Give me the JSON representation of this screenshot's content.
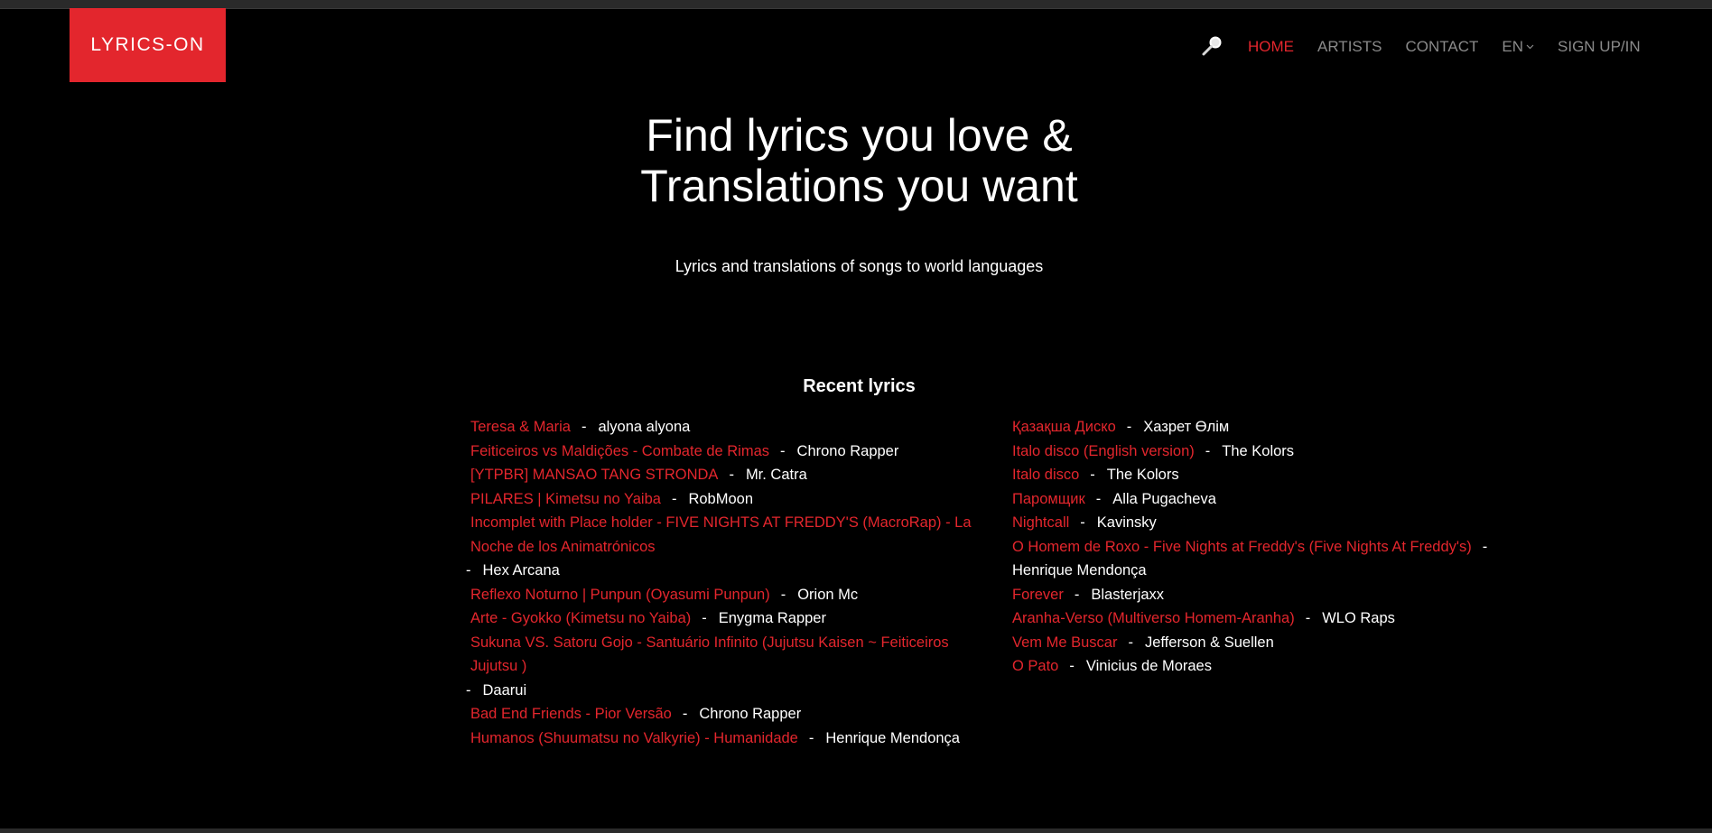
{
  "brand": {
    "logo_text": "LYRICS-ON"
  },
  "nav": {
    "search_icon": "magnifier-icon",
    "home": "HOME",
    "artists": "ARTISTS",
    "contact": "CONTACT",
    "language": "EN",
    "signup": "SIGN UP/IN"
  },
  "hero": {
    "title_line1": "Find lyrics you love &",
    "title_line2": "Translations you want",
    "subtitle": "Lyrics and translations of songs to world languages"
  },
  "recent": {
    "heading": "Recent lyrics",
    "separator": "-",
    "left": [
      {
        "song": "Teresa & Maria",
        "artist": "alyona alyona"
      },
      {
        "song": "Feiticeiros vs Maldições - Combate de Rimas",
        "artist": "Chrono Rapper"
      },
      {
        "song": "[YTPBR] MANSAO TANG STRONDA",
        "artist": "Mr. Catra"
      },
      {
        "song": "PILARES | Kimetsu no Yaiba",
        "artist": "RobMoon"
      },
      {
        "song": "Incomplet with Place holder - FIVE NIGHTS AT FREDDY'S (MacroRap) - La Noche de los Animatrónicos",
        "artist": "Hex Arcana"
      },
      {
        "song": "Reflexo Noturno | Punpun (Oyasumi Punpun)",
        "artist": "Orion Mc"
      },
      {
        "song": "Arte - Gyokko (Kimetsu no Yaiba)",
        "artist": "Enygma Rapper"
      },
      {
        "song": "Sukuna VS. Satoru Gojo - Santuário Infinito (Jujutsu Kaisen ~ Feiticeiros Jujutsu )",
        "artist": "Daarui"
      },
      {
        "song": "Bad End Friends - Pior Versão",
        "artist": "Chrono Rapper"
      },
      {
        "song": "Humanos (Shuumatsu no Valkyrie) - Humanidade",
        "artist": "Henrique Mendonça"
      }
    ],
    "right": [
      {
        "song": "Қазақша Диско",
        "artist": "Хазрет Өлім"
      },
      {
        "song": "Italo disco (English version)",
        "artist": "The Kolors"
      },
      {
        "song": "Italo disco",
        "artist": "The Kolors"
      },
      {
        "song": "Паромщик",
        "artist": "Alla Pugacheva"
      },
      {
        "song": "Nightcall",
        "artist": "Kavinsky"
      },
      {
        "song": "O Homem de Roxo - Five Nights at Freddy's (Five Nights At Freddy's)",
        "artist": "Henrique Mendonça"
      },
      {
        "song": "Forever",
        "artist": "Blasterjaxx"
      },
      {
        "song": "Aranha-Verso (Multiverso Homem-Aranha)",
        "artist": "WLO Raps"
      },
      {
        "song": "Vem Me Buscar",
        "artist": "Jefferson & Suellen"
      },
      {
        "song": "O Pato",
        "artist": "Vinicius de Moraes"
      }
    ]
  },
  "colors": {
    "accent": "#e3262d",
    "background": "#000000",
    "nav_text": "#8a8a8a",
    "text": "#ffffff"
  }
}
